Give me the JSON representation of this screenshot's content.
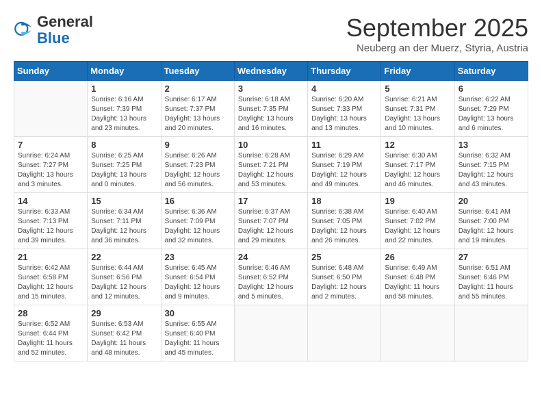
{
  "header": {
    "logo_general": "General",
    "logo_blue": "Blue",
    "month_title": "September 2025",
    "subtitle": "Neuberg an der Muerz, Styria, Austria"
  },
  "days_of_week": [
    "Sunday",
    "Monday",
    "Tuesday",
    "Wednesday",
    "Thursday",
    "Friday",
    "Saturday"
  ],
  "weeks": [
    [
      {
        "day": "",
        "info": ""
      },
      {
        "day": "1",
        "info": "Sunrise: 6:16 AM\nSunset: 7:39 PM\nDaylight: 13 hours\nand 23 minutes."
      },
      {
        "day": "2",
        "info": "Sunrise: 6:17 AM\nSunset: 7:37 PM\nDaylight: 13 hours\nand 20 minutes."
      },
      {
        "day": "3",
        "info": "Sunrise: 6:18 AM\nSunset: 7:35 PM\nDaylight: 13 hours\nand 16 minutes."
      },
      {
        "day": "4",
        "info": "Sunrise: 6:20 AM\nSunset: 7:33 PM\nDaylight: 13 hours\nand 13 minutes."
      },
      {
        "day": "5",
        "info": "Sunrise: 6:21 AM\nSunset: 7:31 PM\nDaylight: 13 hours\nand 10 minutes."
      },
      {
        "day": "6",
        "info": "Sunrise: 6:22 AM\nSunset: 7:29 PM\nDaylight: 13 hours\nand 6 minutes."
      }
    ],
    [
      {
        "day": "7",
        "info": "Sunrise: 6:24 AM\nSunset: 7:27 PM\nDaylight: 13 hours\nand 3 minutes."
      },
      {
        "day": "8",
        "info": "Sunrise: 6:25 AM\nSunset: 7:25 PM\nDaylight: 13 hours\nand 0 minutes."
      },
      {
        "day": "9",
        "info": "Sunrise: 6:26 AM\nSunset: 7:23 PM\nDaylight: 12 hours\nand 56 minutes."
      },
      {
        "day": "10",
        "info": "Sunrise: 6:28 AM\nSunset: 7:21 PM\nDaylight: 12 hours\nand 53 minutes."
      },
      {
        "day": "11",
        "info": "Sunrise: 6:29 AM\nSunset: 7:19 PM\nDaylight: 12 hours\nand 49 minutes."
      },
      {
        "day": "12",
        "info": "Sunrise: 6:30 AM\nSunset: 7:17 PM\nDaylight: 12 hours\nand 46 minutes."
      },
      {
        "day": "13",
        "info": "Sunrise: 6:32 AM\nSunset: 7:15 PM\nDaylight: 12 hours\nand 43 minutes."
      }
    ],
    [
      {
        "day": "14",
        "info": "Sunrise: 6:33 AM\nSunset: 7:13 PM\nDaylight: 12 hours\nand 39 minutes."
      },
      {
        "day": "15",
        "info": "Sunrise: 6:34 AM\nSunset: 7:11 PM\nDaylight: 12 hours\nand 36 minutes."
      },
      {
        "day": "16",
        "info": "Sunrise: 6:36 AM\nSunset: 7:09 PM\nDaylight: 12 hours\nand 32 minutes."
      },
      {
        "day": "17",
        "info": "Sunrise: 6:37 AM\nSunset: 7:07 PM\nDaylight: 12 hours\nand 29 minutes."
      },
      {
        "day": "18",
        "info": "Sunrise: 6:38 AM\nSunset: 7:05 PM\nDaylight: 12 hours\nand 26 minutes."
      },
      {
        "day": "19",
        "info": "Sunrise: 6:40 AM\nSunset: 7:02 PM\nDaylight: 12 hours\nand 22 minutes."
      },
      {
        "day": "20",
        "info": "Sunrise: 6:41 AM\nSunset: 7:00 PM\nDaylight: 12 hours\nand 19 minutes."
      }
    ],
    [
      {
        "day": "21",
        "info": "Sunrise: 6:42 AM\nSunset: 6:58 PM\nDaylight: 12 hours\nand 15 minutes."
      },
      {
        "day": "22",
        "info": "Sunrise: 6:44 AM\nSunset: 6:56 PM\nDaylight: 12 hours\nand 12 minutes."
      },
      {
        "day": "23",
        "info": "Sunrise: 6:45 AM\nSunset: 6:54 PM\nDaylight: 12 hours\nand 9 minutes."
      },
      {
        "day": "24",
        "info": "Sunrise: 6:46 AM\nSunset: 6:52 PM\nDaylight: 12 hours\nand 5 minutes."
      },
      {
        "day": "25",
        "info": "Sunrise: 6:48 AM\nSunset: 6:50 PM\nDaylight: 12 hours\nand 2 minutes."
      },
      {
        "day": "26",
        "info": "Sunrise: 6:49 AM\nSunset: 6:48 PM\nDaylight: 11 hours\nand 58 minutes."
      },
      {
        "day": "27",
        "info": "Sunrise: 6:51 AM\nSunset: 6:46 PM\nDaylight: 11 hours\nand 55 minutes."
      }
    ],
    [
      {
        "day": "28",
        "info": "Sunrise: 6:52 AM\nSunset: 6:44 PM\nDaylight: 11 hours\nand 52 minutes."
      },
      {
        "day": "29",
        "info": "Sunrise: 6:53 AM\nSunset: 6:42 PM\nDaylight: 11 hours\nand 48 minutes."
      },
      {
        "day": "30",
        "info": "Sunrise: 6:55 AM\nSunset: 6:40 PM\nDaylight: 11 hours\nand 45 minutes."
      },
      {
        "day": "",
        "info": ""
      },
      {
        "day": "",
        "info": ""
      },
      {
        "day": "",
        "info": ""
      },
      {
        "day": "",
        "info": ""
      }
    ]
  ]
}
